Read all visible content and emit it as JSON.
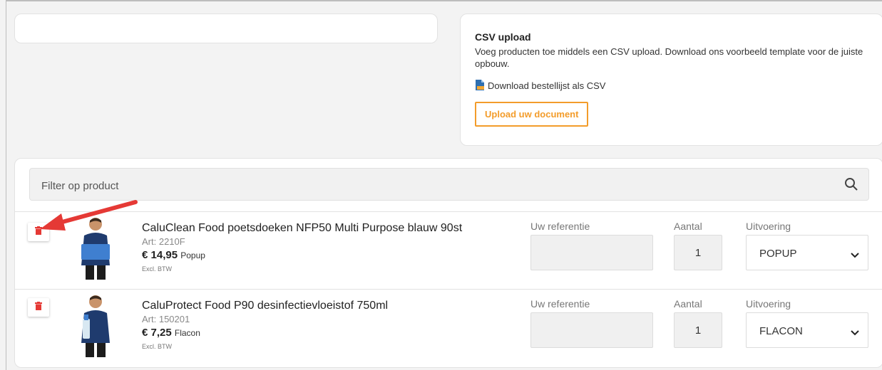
{
  "csv": {
    "title": "CSV upload",
    "description": "Voeg producten toe middels een CSV upload. Download ons voorbeeld template voor de juiste opbouw.",
    "download_label": "Download bestellijst als CSV",
    "upload_label": "Upload uw document"
  },
  "filter": {
    "placeholder": "Filter op product"
  },
  "columns": {
    "reference": "Uw referentie",
    "quantity": "Aantal",
    "variant": "Uitvoering"
  },
  "products": [
    {
      "name": "CaluClean Food poetsdoeken NFP50 Multi Purpose blauw 90st",
      "art": "Art: 2210F",
      "price": "€ 14,95",
      "unit": "Popup",
      "vat": "Excl. BTW",
      "quantity": "1",
      "variant": "POPUP"
    },
    {
      "name": "CaluProtect Food P90 desinfectievloeistof 750ml",
      "art": "Art: 150201",
      "price": "€ 7,25",
      "unit": "Flacon",
      "vat": "Excl. BTW",
      "quantity": "1",
      "variant": "FLACON"
    }
  ],
  "colors": {
    "accent": "#f39c2a",
    "delete": "#e53935",
    "arrow": "#e53935"
  },
  "icons": {
    "search": "search-icon",
    "delete": "trash-icon",
    "csv": "csv-file-icon",
    "chevron": "chevron-down-icon"
  }
}
